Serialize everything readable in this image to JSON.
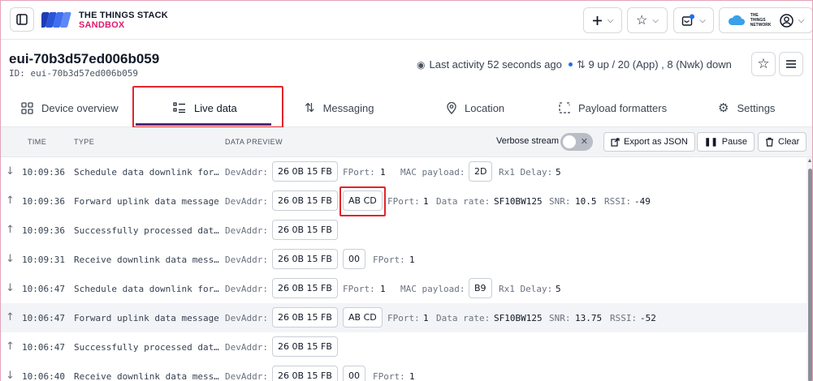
{
  "brand": {
    "line1": "THE THINGS STACK",
    "line2": "SANDBOX",
    "network": "THE THINGS NETWORK"
  },
  "device": {
    "title": "eui-70b3d57ed006b059",
    "id_line": "ID: eui-70b3d57ed006b059",
    "activity": "Last activity 52 seconds ago",
    "counts": "9 up / 20 (App) , 8 (Nwk) down"
  },
  "tabs": [
    {
      "label": "Device overview"
    },
    {
      "label": "Live data"
    },
    {
      "label": "Messaging"
    },
    {
      "label": "Location"
    },
    {
      "label": "Payload formatters"
    },
    {
      "label": "Settings"
    }
  ],
  "table": {
    "headers": {
      "time": "TIME",
      "type": "TYPE",
      "preview": "DATA PREVIEW"
    },
    "verbose_label": "Verbose stream",
    "export_label": "Export as JSON",
    "pause_label": "Pause",
    "clear_label": "Clear"
  },
  "labels": {
    "devaddr": "DevAddr:",
    "fport": "FPort:",
    "mac_payload": "MAC payload:",
    "rx1_delay": "Rx1 Delay:",
    "data_rate": "Data rate:",
    "snr": "SNR:",
    "rssi": "RSSI:"
  },
  "rows": [
    {
      "direction": "down",
      "time": "10:09:36",
      "type": "Schedule data downlink for…",
      "devaddr": "26 0B 15 FB",
      "fport": "1",
      "mac_payload": "2D",
      "rx1_delay": "5"
    },
    {
      "direction": "up",
      "time": "10:09:36",
      "type": "Forward uplink data message",
      "devaddr": "26 0B 15 FB",
      "payload": "AB CD",
      "fport": "1",
      "data_rate": "SF10BW125",
      "snr": "10.5",
      "rssi": "-49"
    },
    {
      "direction": "up",
      "time": "10:09:36",
      "type": "Successfully processed dat…",
      "devaddr": "26 0B 15 FB"
    },
    {
      "direction": "down",
      "time": "10:09:31",
      "type": "Receive downlink data mess…",
      "devaddr": "26 0B 15 FB",
      "payload": "00",
      "fport": "1"
    },
    {
      "direction": "down",
      "time": "10:06:47",
      "type": "Schedule data downlink for…",
      "devaddr": "26 0B 15 FB",
      "fport": "1",
      "mac_payload": "B9",
      "rx1_delay": "5"
    },
    {
      "direction": "up",
      "time": "10:06:47",
      "type": "Forward uplink data message",
      "devaddr": "26 0B 15 FB",
      "payload": "AB CD",
      "fport": "1",
      "data_rate": "SF10BW125",
      "snr": "13.75",
      "rssi": "-52"
    },
    {
      "direction": "up",
      "time": "10:06:47",
      "type": "Successfully processed dat…",
      "devaddr": "26 0B 15 FB"
    },
    {
      "direction": "down",
      "time": "10:06:40",
      "type": "Receive downlink data mess…",
      "devaddr": "26 0B 15 FB",
      "payload": "00",
      "fport": "1"
    }
  ],
  "colors": {
    "accent": "#4a2d7a",
    "brand_pink": "#e0186c",
    "highlight": "#e3242b",
    "status_dot": "#1d6ef2"
  },
  "icons": [
    "sidebar-toggle-icon",
    "plus-icon",
    "star-icon",
    "notifications-icon",
    "cloud-icon",
    "user-icon",
    "menu-icon"
  ]
}
